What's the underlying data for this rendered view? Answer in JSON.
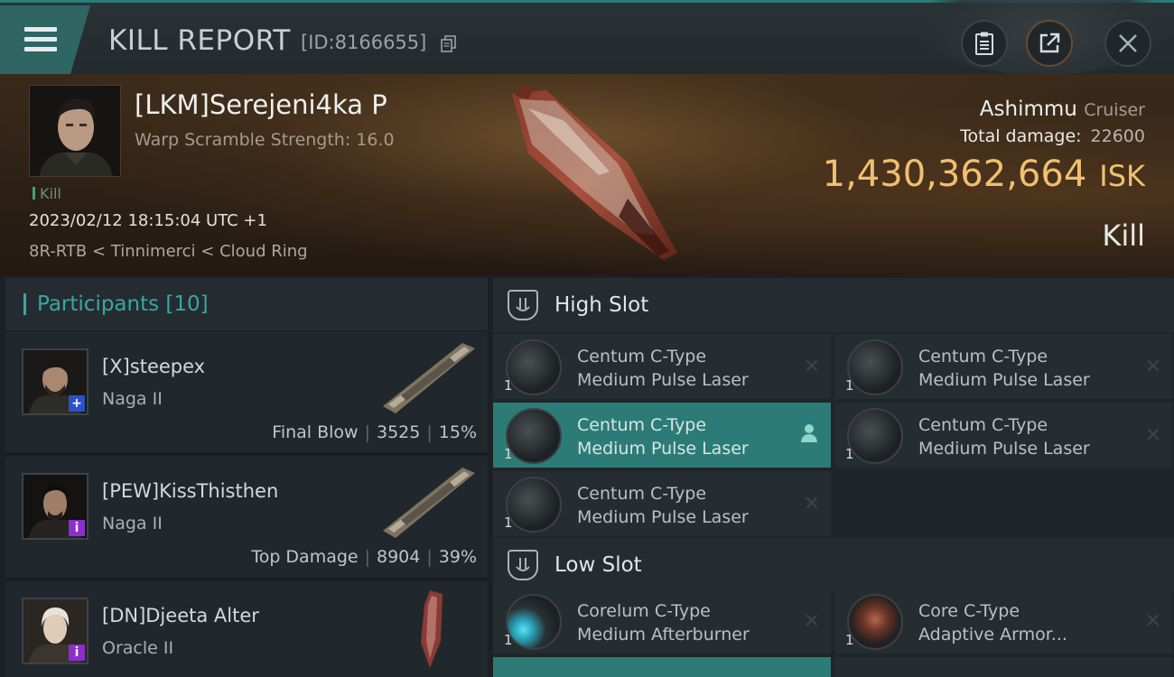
{
  "header": {
    "title": "KILL REPORT",
    "report_id": "[ID:8166655]",
    "icons": [
      "clipboard-icon",
      "share-icon",
      "close-icon",
      "menu-icon",
      "copy-icon"
    ]
  },
  "victim": {
    "name": "[LKM]Serejeni4ka P",
    "warp_scramble": "Warp Scramble Strength: 16.0",
    "tag": "Kill",
    "datetime": "2023/02/12 18:15:04 UTC +1",
    "location": "8R-RTB < Tinnimerci < Cloud Ring",
    "ship_name": "Ashimmu",
    "ship_class": "Cruiser",
    "total_damage_label": "Total damage:",
    "total_damage": "22600",
    "isk_value": "1,430,362,664",
    "isk_unit": "ISK",
    "result": "Kill"
  },
  "participants": {
    "label": "Participants [10]",
    "rows": [
      {
        "name": "[X]steepex",
        "ship": "Naga II",
        "role": "Final Blow",
        "damage": "3525",
        "percent": "15%",
        "badge": "+"
      },
      {
        "name": "[PEW]KissThisthen",
        "ship": "Naga II",
        "role": "Top Damage",
        "damage": "8904",
        "percent": "39%",
        "badge": "i"
      },
      {
        "name": "[DN]Djeeta Alter",
        "ship": "Oracle II",
        "role": "",
        "damage": "",
        "percent": "",
        "badge": "i"
      }
    ]
  },
  "high_slot": {
    "title": "High Slot",
    "modules": [
      {
        "line1": "Centum C-Type",
        "line2": "Medium Pulse Laser",
        "qty": "1",
        "highlight": false
      },
      {
        "line1": "Centum C-Type",
        "line2": "Medium Pulse Laser",
        "qty": "1",
        "highlight": false
      },
      {
        "line1": "Centum C-Type",
        "line2": "Medium Pulse Laser",
        "qty": "1",
        "highlight": true
      },
      {
        "line1": "Centum C-Type",
        "line2": "Medium Pulse Laser",
        "qty": "1",
        "highlight": false
      },
      {
        "line1": "Centum C-Type",
        "line2": "Medium Pulse Laser",
        "qty": "1",
        "highlight": false
      }
    ]
  },
  "low_slot": {
    "title": "Low Slot",
    "modules": [
      {
        "line1": "Corelum C-Type",
        "line2": "Medium Afterburner",
        "qty": "1",
        "highlight": false
      },
      {
        "line1": "Core C-Type",
        "line2": "Adaptive Armor...",
        "qty": "1",
        "highlight": false
      }
    ]
  },
  "colors": {
    "accent": "#38a7a3",
    "isk": "#f0c070",
    "highlight_row": "#2d7b77"
  }
}
